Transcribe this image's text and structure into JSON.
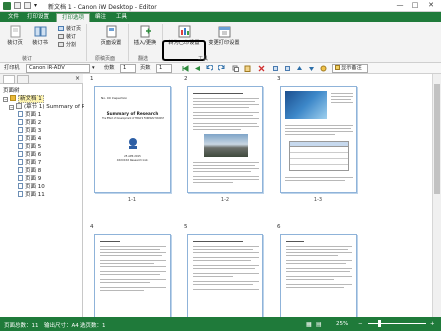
{
  "window": {
    "title": "新文档 1 - Canon iW Desktop - Editor",
    "minimize": "—",
    "maximize": "□",
    "close": "✕"
  },
  "menubar": {
    "tabs": [
      "文件",
      "打印设置",
      "打印选项",
      "编注",
      "工具"
    ],
    "active_index": 2
  },
  "ribbon": {
    "buttons": {
      "full_doc": "装订书",
      "layout_settings": "页方设置",
      "page_settings": "页面设置",
      "insert_replace": "插入/更换",
      "change_print_settings": "转为已印设置",
      "change_print_settings2": "变更打印设置"
    },
    "small": {
      "s1": "装订页",
      "s2": "装订",
      "s3": "分割"
    },
    "groups": [
      "装订",
      "原稿页面",
      "翻选",
      "工具"
    ]
  },
  "printbar": {
    "printer_label": "打印机",
    "printer_value": "Canon iR-ADV",
    "copies_label": "份数",
    "copies_value": "1",
    "pages_label": "页数",
    "pages_value": "1",
    "show_notes": "显示备注"
  },
  "sidebar": {
    "header": "页面树",
    "tree": [
      {
        "label": "新文档 1",
        "level": 0,
        "type": "doc",
        "selected": true
      },
      {
        "label": "(章节 1) Summary of Re",
        "level": 1,
        "type": "section"
      },
      {
        "label": "页面 1",
        "level": 2,
        "type": "page"
      },
      {
        "label": "页面 2",
        "level": 2,
        "type": "page"
      },
      {
        "label": "页面 3",
        "level": 2,
        "type": "page"
      },
      {
        "label": "页面 4",
        "level": 2,
        "type": "page"
      },
      {
        "label": "页面 5",
        "level": 2,
        "type": "page"
      },
      {
        "label": "页面 6",
        "level": 2,
        "type": "page"
      },
      {
        "label": "页面 7",
        "level": 2,
        "type": "page"
      },
      {
        "label": "页面 8",
        "level": 2,
        "type": "page"
      },
      {
        "label": "页面 9",
        "level": 2,
        "type": "page"
      },
      {
        "label": "页面 10",
        "level": 2,
        "type": "page"
      },
      {
        "label": "页面 11",
        "level": 2,
        "type": "page"
      }
    ]
  },
  "pages": {
    "numbers": [
      "1",
      "2",
      "3",
      "4",
      "5",
      "6"
    ],
    "labels": [
      "1-1",
      "1-2",
      "1-3"
    ],
    "p1": {
      "header": "No. 00 Inspection",
      "title": "Summary of Research",
      "subtitle": "The Effect of Development of TMDA'S FOREIGN TOURIST",
      "date": "25 APR 2015",
      "org": "XXXXXXX Research Inst."
    }
  },
  "statusbar": {
    "total_pages": "页面总数：11",
    "output_size": "输出尺寸：A4",
    "selected": "选页数：1",
    "zoom": "25%"
  },
  "colors": {
    "brand": "#1f7a3a",
    "page_border": "#8fb3d9"
  }
}
